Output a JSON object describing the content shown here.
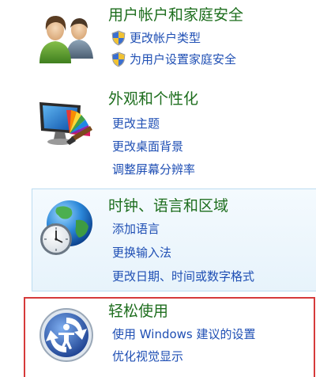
{
  "user_accounts": {
    "title": "用户帐户和家庭安全",
    "links": [
      "更改帐户类型",
      "为用户设置家庭安全"
    ]
  },
  "appearance": {
    "title": "外观和个性化",
    "links": [
      "更改主题",
      "更改桌面背景",
      "调整屏幕分辨率"
    ]
  },
  "clock_region": {
    "title": "时钟、语言和区域",
    "links": [
      "添加语言",
      "更换输入法",
      "更改日期、时间或数字格式"
    ]
  },
  "ease_of_access": {
    "title": "轻松使用",
    "links": [
      "使用 Windows 建议的设置",
      "优化视觉显示"
    ]
  },
  "colors": {
    "title_green": "#1e6e1e",
    "link_blue": "#1f4fb4",
    "highlight_border": "#bcdcf1",
    "selection_red": "#d63a3a"
  }
}
